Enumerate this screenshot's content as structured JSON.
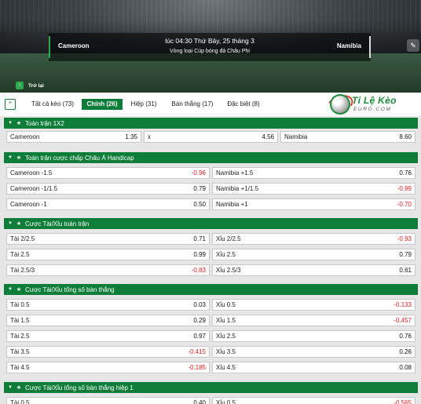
{
  "header": {
    "home_team": "Cameroon",
    "away_team": "Namibia",
    "time": "lúc 04:30 Thứ Bảy, 25 tháng 3",
    "league": "Vòng loại Cúp bóng đá Châu Phi",
    "back_label": "Trở lại"
  },
  "tabs": [
    {
      "label": "Tất cả kèo (73)",
      "active": false
    },
    {
      "label": "Chính (26)",
      "active": true
    },
    {
      "label": "Hiệp (31)",
      "active": false
    },
    {
      "label": "Bàn thắng (17)",
      "active": false
    },
    {
      "label": "Đặc biệt (8)",
      "active": false
    }
  ],
  "logo": {
    "brand": "Tỉ Lệ Kèo",
    "sub": "EURO.COM"
  },
  "colors": {
    "primary": "#0f7d3a",
    "negative": "#e02020"
  },
  "sections": [
    {
      "title": "Toàn trận 1X2",
      "rows": [
        [
          {
            "label": "Cameroon",
            "odd": "1.35"
          },
          {
            "label": "x",
            "odd": "4.56"
          },
          {
            "label": "Namibia",
            "odd": "8.60"
          }
        ]
      ]
    },
    {
      "title": "Toàn trận cược chấp Châu Á Handicap",
      "rows": [
        [
          {
            "label": "Cameroon -1.5",
            "odd": "-0.96"
          },
          {
            "label": "Namibia +1.5",
            "odd": "0.76"
          }
        ],
        [
          {
            "label": "Cameroon -1/1.5",
            "odd": "0.79"
          },
          {
            "label": "Namibia +1/1.5",
            "odd": "-0.99"
          }
        ],
        [
          {
            "label": "Cameroon -1",
            "odd": "0.50"
          },
          {
            "label": "Namibia +1",
            "odd": "-0.70"
          }
        ]
      ]
    },
    {
      "title": "Cược Tài/Xỉu toàn trận",
      "rows": [
        [
          {
            "label": "Tài 2/2.5",
            "odd": "0.71"
          },
          {
            "label": "Xỉu 2/2.5",
            "odd": "-0.93"
          }
        ],
        [
          {
            "label": "Tài 2.5",
            "odd": "0.99"
          },
          {
            "label": "Xỉu 2.5",
            "odd": "0.79"
          }
        ],
        [
          {
            "label": "Tài 2.5/3",
            "odd": "-0.83"
          },
          {
            "label": "Xỉu 2.5/3",
            "odd": "0.61"
          }
        ]
      ]
    },
    {
      "title": "Cược Tài/Xỉu tổng số bàn thắng",
      "rows": [
        [
          {
            "label": "Tài 0.5",
            "odd": "0.03"
          },
          {
            "label": "Xỉu 0.5",
            "odd": "-0.133"
          }
        ],
        [
          {
            "label": "Tài 1.5",
            "odd": "0.29"
          },
          {
            "label": "Xỉu 1.5",
            "odd": "-0.457"
          }
        ],
        [
          {
            "label": "Tài 2.5",
            "odd": "0.97"
          },
          {
            "label": "Xỉu 2.5",
            "odd": "0.76"
          }
        ],
        [
          {
            "label": "Tài 3.5",
            "odd": "-0.415"
          },
          {
            "label": "Xỉu 3.5",
            "odd": "0.26"
          }
        ],
        [
          {
            "label": "Tài 4.5",
            "odd": "-0.185"
          },
          {
            "label": "Xỉu 4.5",
            "odd": "0.08"
          }
        ]
      ]
    },
    {
      "title": "Cược Tài/Xỉu tổng số bàn thắng hiệp 1",
      "rows": [
        [
          {
            "label": "Tài 0.5",
            "odd": "0.40"
          },
          {
            "label": "Xỉu 0.5",
            "odd": "-0.565"
          }
        ]
      ]
    }
  ]
}
